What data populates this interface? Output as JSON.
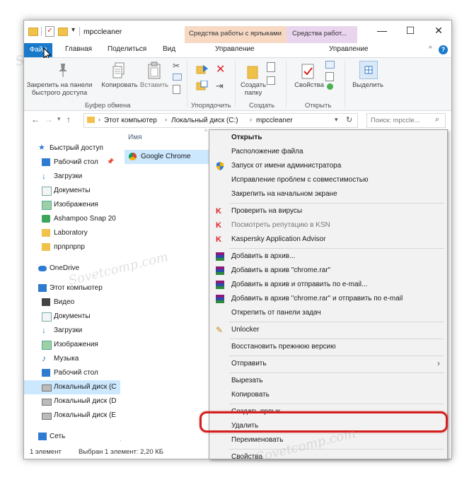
{
  "titlebar": {
    "folder_name": "mpccleaner",
    "ctx_tab_shortcuts": "Средства работы с ярлыками",
    "ctx_tab_drive": "Средства работ...",
    "minimize": "—",
    "maximize": "☐",
    "close": "✕"
  },
  "tabs": {
    "file": "Файл",
    "home": "Главная",
    "share": "Поделиться",
    "view": "Вид",
    "manage1": "Управление",
    "manage2": "Управление"
  },
  "ribbon": {
    "pin_line1": "Закрепить на панели",
    "pin_line2": "быстрого доступа",
    "copy": "Копировать",
    "paste": "Вставить",
    "new_folder_line1": "Создать",
    "new_folder_line2": "папку",
    "properties": "Свойства",
    "select": "Выделить",
    "group_clipboard": "Буфер обмена",
    "group_organize": "Упорядочить",
    "group_new": "Создать",
    "group_open": "Открыть"
  },
  "address": {
    "crumb1": "Этот компьютер",
    "crumb2": "Локальный диск (C:)",
    "crumb3": "mpccleaner",
    "search_placeholder": "Поиск: mpccle..."
  },
  "nav": {
    "quick_access": "Быстрый доступ",
    "desktop": "Рабочий стол",
    "downloads": "Загрузки",
    "documents": "Документы",
    "pictures": "Изображения",
    "ashampoo": "Ashampoo Snap 20",
    "laboratory": "Laboratory",
    "npnpnpnp": "прпрпрпр",
    "onedrive": "OneDrive",
    "this_pc": "Этот компьютер",
    "video": "Видео",
    "documents2": "Документы",
    "downloads2": "Загрузки",
    "pictures2": "Изображения",
    "music": "Музыка",
    "desktop2": "Рабочий стол",
    "disk_c": "Локальный диск (С",
    "disk_d": "Локальный диск (D",
    "disk_e": "Локальный диск (Е",
    "network": "Сеть"
  },
  "content": {
    "col_name": "Имя",
    "file_name": "Google Chrome"
  },
  "status": {
    "count": "1 элемент",
    "selected": "Выбран 1 элемент: 2,20 КБ"
  },
  "context_menu": {
    "open": "Открыть",
    "file_location": "Расположение файла",
    "run_as_admin": "Запуск от имени администратора",
    "fix_compat": "Исправление проблем с совместимостью",
    "pin_start": "Закрепить на начальном экране",
    "check_virus": "Проверить на вирусы",
    "ksn": "Посмотреть репутацию в KSN",
    "kaspersky": "Kaspersky Application Advisor",
    "add_archive": "Добавить в архив...",
    "add_rar": "Добавить в архив \"chrome.rar\"",
    "add_email": "Добавить в архив и отправить по e-mail...",
    "add_rar_email": "Добавить в архив \"chrome.rar\" и отправить по e-mail",
    "unpin_taskbar": "Открепить от панели задач",
    "unlocker": "Unlocker",
    "restore": "Восстановить прежнюю версию",
    "send_to": "Отправить",
    "cut": "Вырезать",
    "copy": "Копировать",
    "create_shortcut": "Создать ярлык",
    "delete": "Удалить",
    "rename": "Переименовать",
    "properties": "Свойства"
  },
  "colors": {
    "accent": "#1979ca",
    "selection": "#cce8ff",
    "highlight_ring": "#d31f1f"
  }
}
